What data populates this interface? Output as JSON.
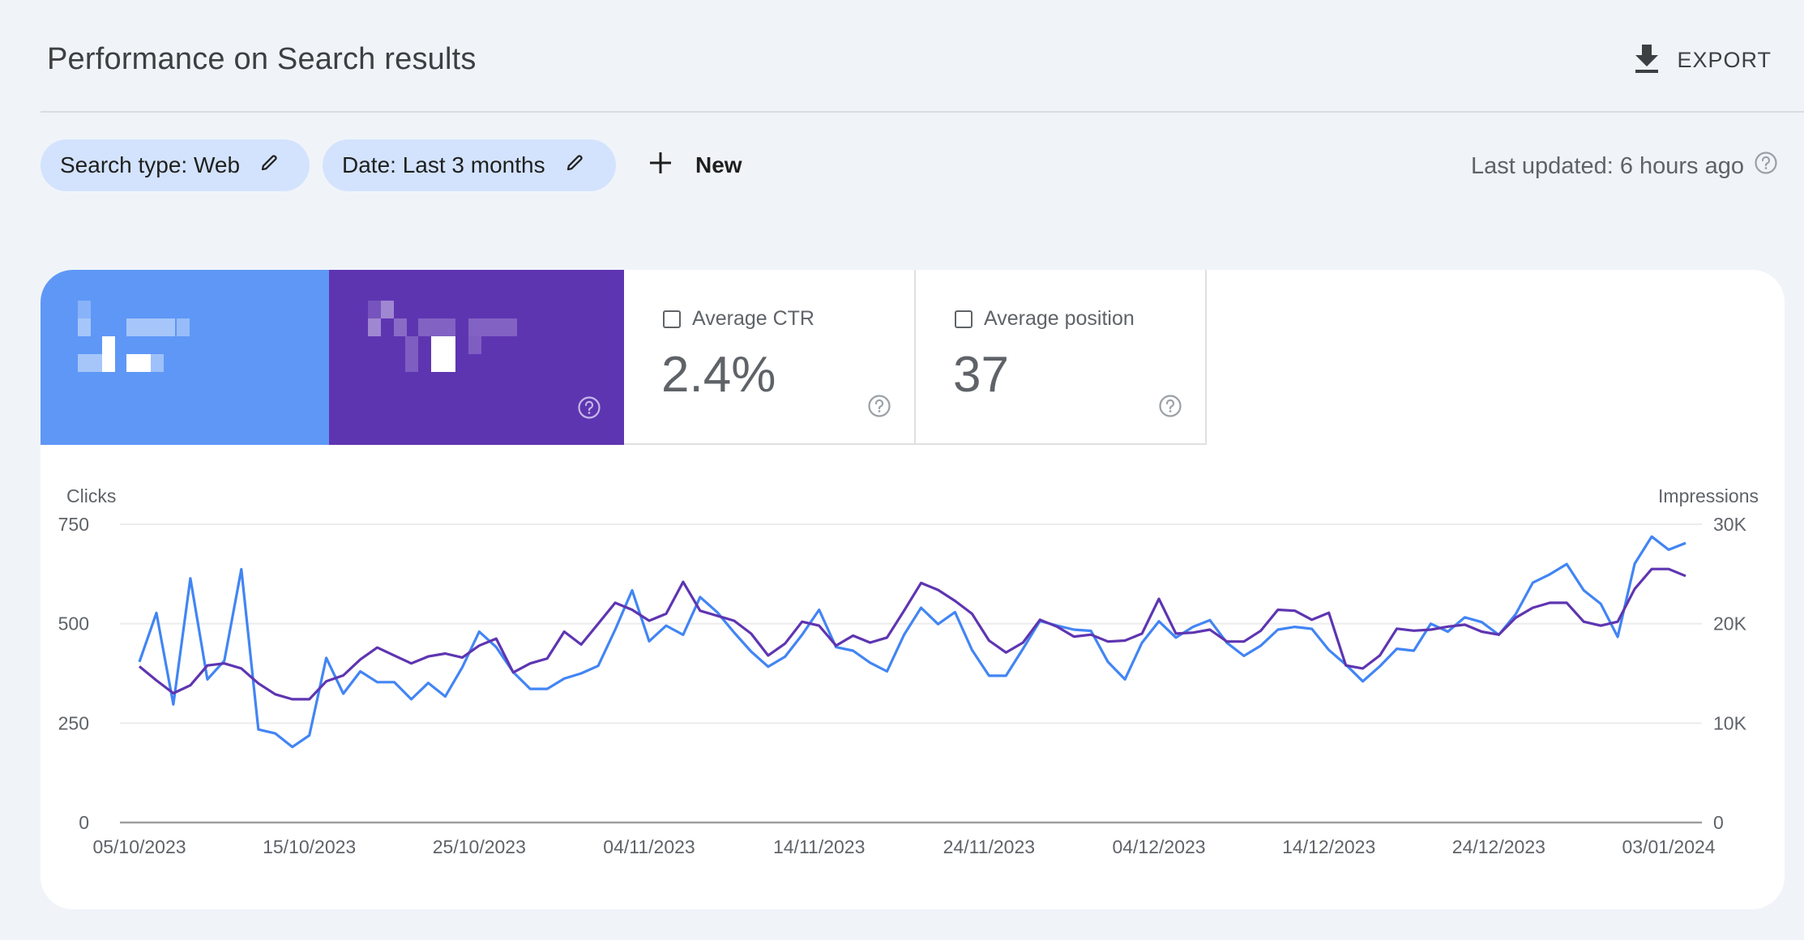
{
  "header": {
    "title": "Performance on Search results",
    "export_label": "EXPORT",
    "export_icon": "download-icon"
  },
  "filters": {
    "chips": [
      {
        "label": "Search type: Web",
        "icon": "pencil-icon"
      },
      {
        "label": "Date: Last 3 months",
        "icon": "pencil-icon"
      }
    ],
    "new_label": "New",
    "new_icon": "plus-icon",
    "last_updated": "Last updated: 6 hours ago",
    "help_icon": "help-circle-icon"
  },
  "metrics": [
    {
      "name": "Total clicks",
      "label": "[redacted]",
      "value": "[redacted]",
      "selected": true,
      "color": "#5e97f6"
    },
    {
      "name": "Total impressions",
      "label": "[redacted]",
      "value": "[redacted]",
      "selected": true,
      "color": "#5e35b1"
    },
    {
      "name": "Average CTR",
      "label": "Average CTR",
      "value": "2.4%",
      "selected": false
    },
    {
      "name": "Average position",
      "label": "Average position",
      "value": "37",
      "selected": false
    }
  ],
  "chart_data": {
    "type": "line",
    "title": "",
    "left_axis": {
      "label": "Clicks",
      "ticks": [
        "0",
        "250",
        "500",
        "750"
      ],
      "range": [
        0,
        750
      ]
    },
    "right_axis": {
      "label": "Impressions",
      "ticks": [
        "0",
        "10K",
        "20K",
        "30K"
      ],
      "range": [
        0,
        30000
      ]
    },
    "x_start": "05/10/2023",
    "x_end": "04/01/2024",
    "x_tick_labels": [
      "05/10/2023",
      "15/10/2023",
      "25/10/2023",
      "04/11/2023",
      "14/11/2023",
      "24/11/2023",
      "04/12/2023",
      "14/12/2023",
      "24/12/2023",
      "03/01/2024"
    ],
    "x_tick_every_days": 10,
    "grid": true,
    "series": [
      {
        "name": "Clicks",
        "axis": "left",
        "color": "#4285f4",
        "values": [
          404,
          527,
          297,
          614,
          360,
          407,
          637,
          234,
          224,
          190,
          219,
          414,
          324,
          380,
          353,
          353,
          310,
          351,
          317,
          390,
          480,
          441,
          378,
          336,
          336,
          362,
          375,
          394,
          485,
          584,
          456,
          495,
          472,
          567,
          529,
          478,
          430,
          392,
          417,
          472,
          535,
          441,
          432,
          402,
          380,
          472,
          540,
          499,
          529,
          434,
          369,
          369,
          437,
          507,
          495,
          485,
          482,
          404,
          360,
          452,
          506,
          465,
          492,
          509,
          452,
          419,
          445,
          485,
          492,
          487,
          434,
          397,
          355,
          393,
          437,
          432,
          500,
          480,
          516,
          504,
          472,
          524,
          603,
          624,
          650,
          584,
          550,
          467,
          651,
          719,
          686,
          703
        ]
      },
      {
        "name": "Impressions",
        "axis": "right",
        "color": "#5e35b1",
        "values": [
          15700,
          14300,
          13000,
          13800,
          15800,
          16000,
          15500,
          14000,
          12900,
          12400,
          12400,
          14200,
          14800,
          16400,
          17600,
          16800,
          16000,
          16700,
          17000,
          16600,
          17800,
          18500,
          15100,
          16000,
          16500,
          19200,
          17900,
          20000,
          22100,
          21400,
          20300,
          21000,
          24200,
          21300,
          20800,
          20300,
          19000,
          16800,
          18000,
          20200,
          19800,
          17800,
          18800,
          18100,
          18600,
          21300,
          24100,
          23400,
          22300,
          21000,
          18300,
          17100,
          18100,
          20400,
          19700,
          18700,
          18900,
          18200,
          18300,
          19000,
          22500,
          19000,
          19100,
          19400,
          18200,
          18200,
          19300,
          21400,
          21300,
          20400,
          21100,
          15800,
          15500,
          16800,
          19500,
          19300,
          19400,
          19700,
          19900,
          19200,
          18900,
          20600,
          21600,
          22100,
          22100,
          20200,
          19800,
          20200,
          23500,
          25500,
          25500,
          24800
        ]
      }
    ]
  }
}
